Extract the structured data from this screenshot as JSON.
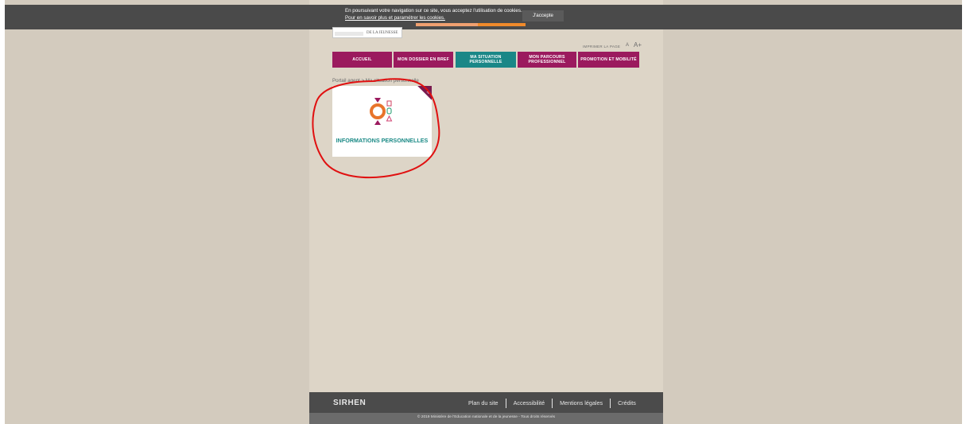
{
  "cookie": {
    "message": "En poursuivant votre navigation sur ce site, vous acceptez l'utilisation de cookies.",
    "link": "Pour en savoir plus et paramétrer les cookies.",
    "accept_label": "J'accepte"
  },
  "header": {
    "logo_text": "DE LA JEUNESSE",
    "print_label": "IMPRIMER LA PAGE",
    "font_small": "A",
    "font_large": "A+"
  },
  "nav": {
    "items": [
      {
        "label": "ACCUEIL"
      },
      {
        "label": "MON DOSSIER EN BREF"
      },
      {
        "label": "MA SITUATION PERSONNELLE"
      },
      {
        "label": "MON PARCOURS PROFESSIONNEL"
      },
      {
        "label": "PROMOTION ET MOBILITÉ"
      }
    ]
  },
  "breadcrumb": "Portail agent > Ma situation personnelle",
  "tile": {
    "label": "INFORMATIONS PERSONNELLES",
    "corner_symbol": "+"
  },
  "footer": {
    "logo": "SIRHEN",
    "links": [
      "Plan du site",
      "Accessibilité",
      "Mentions légales",
      "Crédits"
    ],
    "copyright": "© 2019 Ministère de l'Education nationale et de la jeunesse - Tous droits réservés"
  },
  "colors": {
    "magenta": "#9b1a5e",
    "teal": "#1a8787",
    "orange": "#e8742b",
    "annotation_red": "#e01010"
  }
}
